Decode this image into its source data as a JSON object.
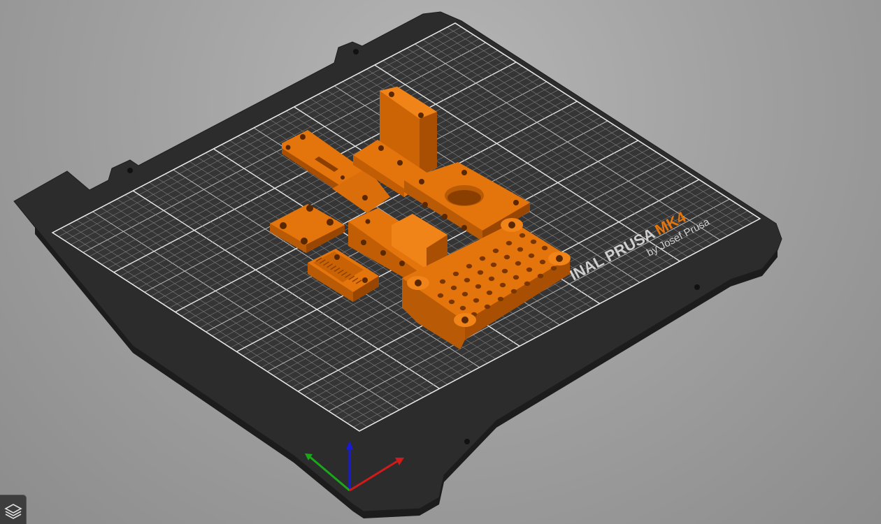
{
  "app": {
    "window": "PrusaSlicer 3D editor view",
    "colors": {
      "background": "#a2a2a2",
      "bed_frame": "#2a2a2a",
      "bed_surface": "#333333",
      "grid_line": "#8a8a8a",
      "grid_major": "#e6e6e6",
      "part_color": "#e4740c",
      "axis_x": "#d11a1a",
      "axis_y": "#1aa81a",
      "axis_z": "#1a1ad6"
    }
  },
  "bed": {
    "logo_brand": "INAL PRUSA",
    "logo_model": "MK4",
    "logo_byline": "by Josef Prusa"
  },
  "parts": [
    {
      "name": "slotted-plate"
    },
    {
      "name": "tall-bracket"
    },
    {
      "name": "motor-mount"
    },
    {
      "name": "square-plate"
    },
    {
      "name": "block-with-holes"
    },
    {
      "name": "toothed-clip"
    },
    {
      "name": "perforated-base"
    }
  ],
  "toolbar": {
    "layer_view_icon": "layers-icon"
  }
}
